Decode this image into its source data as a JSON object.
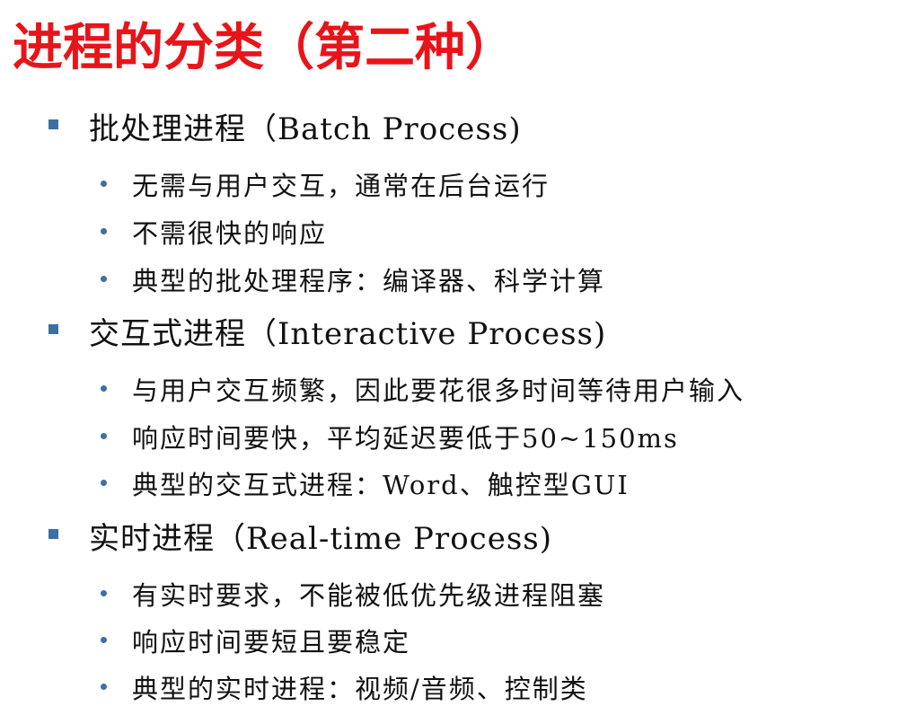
{
  "slide": {
    "title": "进程的分类（第二种）",
    "accent_color": "#e8141a",
    "bullet_color": "#3e6fa3",
    "sections": [
      {
        "heading": "批处理进程（Batch Process)",
        "items": [
          "无需与用户交互，通常在后台运行",
          "不需很快的响应",
          "典型的批处理程序：编译器、科学计算"
        ]
      },
      {
        "heading": "交互式进程（Interactive Process)",
        "items": [
          "与用户交互频繁，因此要花很多时间等待用户输入",
          "响应时间要快，平均延迟要低于50~150ms",
          "典型的交互式进程：Word、触控型GUI"
        ]
      },
      {
        "heading": "实时进程（Real-time Process)",
        "items": [
          "有实时要求，不能被低优先级进程阻塞",
          "响应时间要短且要稳定",
          "典型的实时进程：视频/音频、控制类"
        ]
      }
    ]
  }
}
